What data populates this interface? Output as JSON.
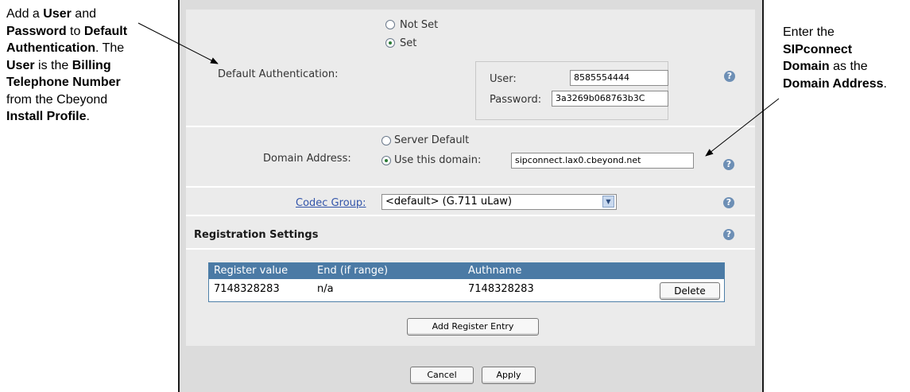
{
  "annotations": {
    "left_note": {
      "lines": [
        [
          "Add a ",
          "User",
          " and"
        ],
        [
          "Password",
          " to ",
          "Default"
        ],
        [
          "Authentication",
          ". The"
        ],
        [
          "User",
          " is the ",
          "Billing"
        ],
        [
          "Telephone Number"
        ],
        [
          "from the Cbeyond"
        ],
        [
          "Install Profile",
          "."
        ]
      ]
    },
    "right_note": {
      "lines": [
        [
          "Enter the"
        ],
        [
          "SIPconnect"
        ],
        [
          "Domain",
          " as the"
        ],
        [
          "Domain Address",
          "."
        ]
      ]
    }
  },
  "default_auth": {
    "label": "Default Authentication:",
    "options": [
      "Not Set",
      "Set"
    ],
    "selected": "Set",
    "user_label": "User:",
    "user_value": "8585554444",
    "password_label": "Password:",
    "password_value": "3a3269b068763b3C"
  },
  "domain": {
    "label": "Domain Address:",
    "options": [
      "Server Default",
      "Use this domain:"
    ],
    "selected": "Use this domain:",
    "value": "sipconnect.lax0.cbeyond.net"
  },
  "codec": {
    "label": "Codec Group:",
    "selected": "<default> (G.711 uLaw)"
  },
  "registration": {
    "title": "Registration Settings",
    "columns": [
      "Register value",
      "End (if range)",
      "Authname"
    ],
    "rows": [
      {
        "register_value": "7148328283",
        "end": "n/a",
        "authname": "7148328283",
        "action": "Delete"
      }
    ],
    "add_label": "Add Register Entry"
  },
  "footer": {
    "cancel_label": "Cancel",
    "apply_label": "Apply"
  },
  "help_glyph": "?",
  "colors": {
    "panel": "#ebebeb",
    "table_header": "#4b7aa5",
    "help_icon": "#6d8fb5",
    "link": "#3355aa"
  }
}
